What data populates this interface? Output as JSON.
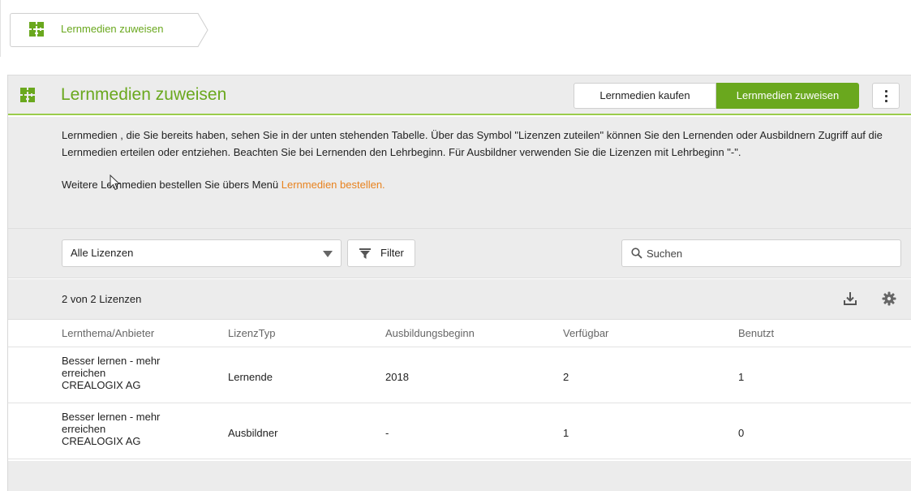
{
  "breadcrumb": {
    "label": "Lernmedien zuweisen",
    "icon": "puzzle-icon"
  },
  "header": {
    "title": "Lernmedien zuweisen",
    "btn_kaufen": "Lernmedien kaufen",
    "btn_zuweisen": "Lernmedien zuweisen",
    "accent": "#6aa81e"
  },
  "intro": {
    "text": "Lernmedien , die Sie bereits haben, sehen Sie in der unten stehenden Tabelle. Über das Symbol \"Lizenzen zuteilen\" können Sie den Lernenden oder Ausbildnern Zugriff auf die Lernmedien erteilen oder entziehen. Beachten Sie bei Lernenden den Lehrbeginn. Für Ausbildner verwenden Sie die Lizenzen mit Lehrbeginn \"-\".",
    "order_prefix": "Weitere Lernmedien bestellen Sie übers Menü ",
    "order_link": "Lernmedien bestellen.",
    "link_color": "#e8821e"
  },
  "filters": {
    "select_value": "Alle Lizenzen",
    "filter_label": "Filter",
    "search_placeholder": "Suchen"
  },
  "count": "2 von 2 Lizenzen",
  "table": {
    "columns": [
      "Lernthema/Anbieter",
      "LizenzTyp",
      "Ausbildungsbeginn",
      "Verfügbar",
      "Benutzt"
    ],
    "rows": [
      {
        "title_line1": "Besser lernen - mehr",
        "title_line2": "erreichen",
        "provider": "CREALOGIX AG",
        "type": "Lernende",
        "start": "2018",
        "available": "2",
        "used": "1"
      },
      {
        "title_line1": "Besser lernen - mehr",
        "title_line2": "erreichen",
        "provider": "CREALOGIX AG",
        "type": "Ausbildner",
        "start": "-",
        "available": "1",
        "used": "0"
      }
    ]
  }
}
